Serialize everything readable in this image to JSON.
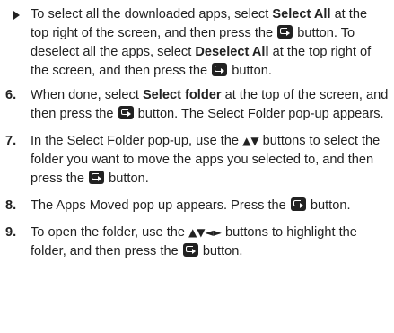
{
  "bullet": {
    "t1": "To select all the downloaded apps, select ",
    "select_all": "Select All",
    "t2": " at the top right of the screen, and then press the ",
    "t3": " button. To deselect all the apps, select ",
    "deselect_all": "Deselect All",
    "t4": " at the top right of the screen, and then press the ",
    "t5": " button."
  },
  "steps": [
    {
      "num": "6.",
      "t1": "When done, select ",
      "bold": "Select folder",
      "t2": " at the top of the screen, and then press the ",
      "t3": " button. The Select Folder pop-up appears."
    },
    {
      "num": "7.",
      "t1": "In the Select Folder pop-up, use the ",
      "arrows": "▲▼",
      "t2": " buttons to select the folder you want to move the apps you selected to, and then press the ",
      "t3": " button."
    },
    {
      "num": "8.",
      "t1": "The Apps Moved pop up appears. Press the ",
      "t2": " button."
    },
    {
      "num": "9.",
      "t1": "To open the folder, use the ",
      "arrows": "▲▼◄►",
      "t2": " buttons to highlight the folder, and then press the ",
      "t3": " button."
    }
  ],
  "icons": {
    "enter": "enter-button-icon",
    "bullet": "triangle-bullet-icon"
  },
  "colors": {
    "text": "#222222",
    "background": "#ffffff"
  }
}
